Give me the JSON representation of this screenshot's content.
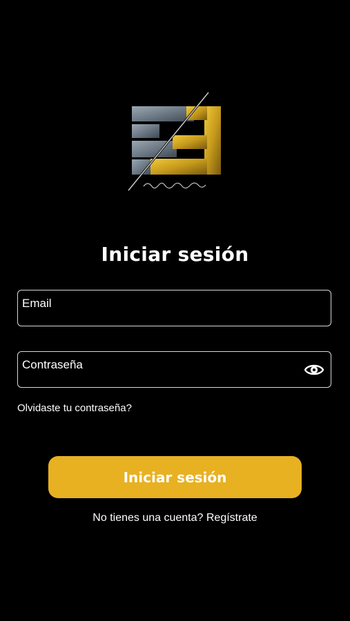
{
  "logo": {
    "name": "brand-logo",
    "signature_text": "Francisco Gazón"
  },
  "title": "Iniciar sesión",
  "form": {
    "email_placeholder": "Email",
    "password_placeholder": "Contraseña",
    "password_toggle_icon": "eye-icon",
    "forgot_label": "Olvidaste tu contraseña?",
    "submit_label": "Iniciar sesión"
  },
  "footer": {
    "prompt": "No tienes una cuenta?",
    "register_label": "Regístrate"
  },
  "colors": {
    "background": "#000000",
    "accent": "#e8b122",
    "text": "#ffffff",
    "field_border": "#d9d9d9"
  }
}
